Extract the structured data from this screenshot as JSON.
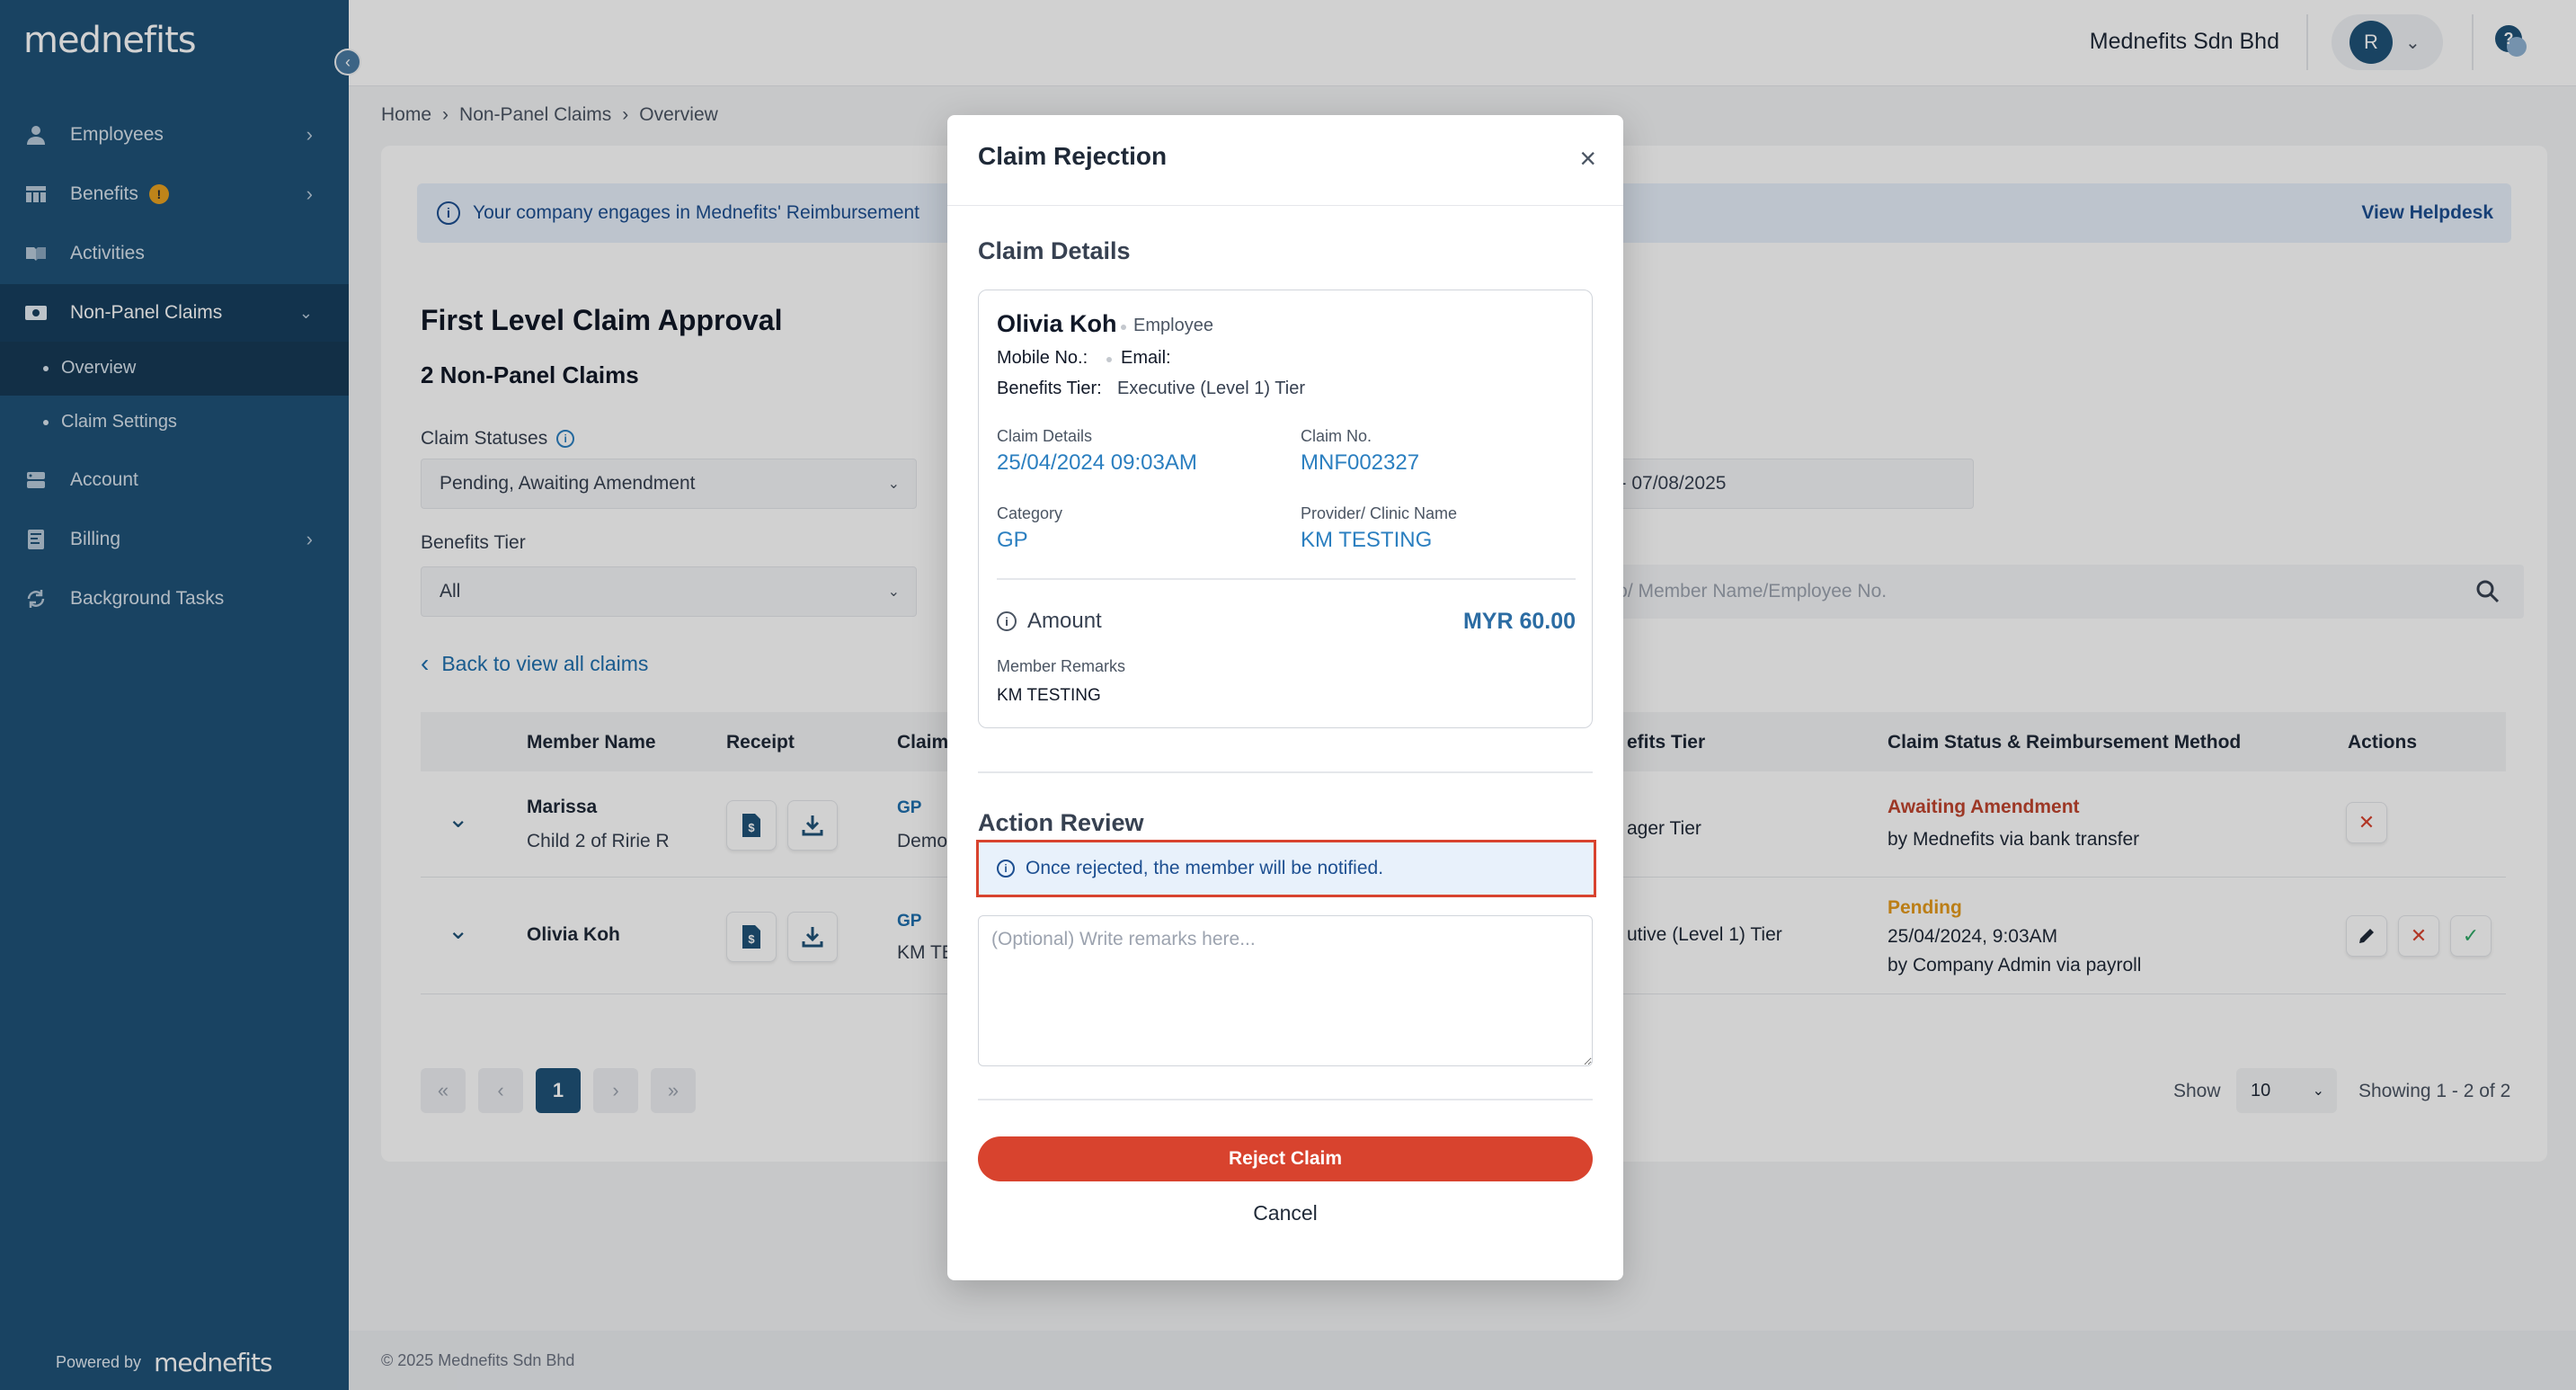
{
  "brand": {
    "logo_text": "mednefits",
    "powered_by": "Powered by",
    "powered_logo": "mednefits"
  },
  "sidebar": {
    "items": [
      {
        "label": "Employees",
        "icon": "person-icon"
      },
      {
        "label": "Benefits",
        "icon": "table-icon",
        "badge": "!"
      },
      {
        "label": "Activities",
        "icon": "book-icon"
      },
      {
        "label": "Non-Panel Claims",
        "icon": "money-icon"
      },
      {
        "label": "Account",
        "icon": "account-icon"
      },
      {
        "label": "Billing",
        "icon": "billing-icon"
      },
      {
        "label": "Background Tasks",
        "icon": "sync-icon"
      }
    ],
    "sub_items": [
      {
        "label": "Overview"
      },
      {
        "label": "Claim Settings"
      }
    ]
  },
  "topbar": {
    "company": "Mednefits Sdn Bhd",
    "avatar_initial": "R",
    "help_icon": "?"
  },
  "breadcrumb": {
    "home": "Home",
    "section": "Non-Panel Claims",
    "page": "Overview"
  },
  "banner": {
    "text": "Your company engages in Mednefits' Reimbursement",
    "link": "View Helpdesk"
  },
  "main": {
    "title": "First Level Claim Approval",
    "subtitle": "2 Non-Panel Claims",
    "status_label": "Claim Statuses",
    "status_value": "Pending, Awaiting Amendment",
    "date_value": "2 - 07/08/2025",
    "tier_label": "Benefits Tier",
    "tier_value": "All",
    "search_placeholder": "No/ Member Name/Employee No.",
    "back_link": "Back to view all claims"
  },
  "table": {
    "headers": {
      "member": "Member Name",
      "receipt": "Receipt",
      "claim": "Claim",
      "tier": "efits Tier",
      "status": "Claim Status & Reimbursement Method",
      "actions": "Actions"
    },
    "rows": [
      {
        "name": "Marissa",
        "relation": "Child 2 of Ririe R",
        "category": "GP",
        "provider": "Demo",
        "tier": "ager Tier",
        "status": "Awaiting Amendment",
        "method": "by Mednefits via bank transfer",
        "status_color": "#c0452f"
      },
      {
        "name": "Olivia Koh",
        "category": "GP",
        "provider": "KM TES",
        "tier": "utive (Level 1) Tier",
        "status": "Pending",
        "date": "25/04/2024, 9:03AM",
        "method": "by Company Admin via payroll",
        "status_color": "#e59a1b"
      }
    ]
  },
  "pagination": {
    "first": "«",
    "prev": "‹",
    "current": "1",
    "next": "›",
    "last": "»",
    "show_label": "Show",
    "page_size": "10",
    "showing": "Showing 1 - 2 of 2"
  },
  "footer": {
    "copyright": "© 2025 Mednefits Sdn Bhd"
  },
  "modal": {
    "title": "Claim Rejection",
    "close": "×",
    "details_title": "Claim Details",
    "employee_name": "Olivia Koh",
    "employee_role": "Employee",
    "mobile_label": "Mobile No.:",
    "email_label": "Email:",
    "tier_label": "Benefits Tier:",
    "tier_value": "Executive (Level 1) Tier",
    "claim_details_label": "Claim Details",
    "claim_details_value": "25/04/2024 09:03AM",
    "claim_no_label": "Claim No.",
    "claim_no_value": "MNF002327",
    "category_label": "Category",
    "category_value": "GP",
    "provider_label": "Provider/ Clinic Name",
    "provider_value": "KM TESTING",
    "amount_label": "Amount",
    "amount_value": "MYR 60.00",
    "remarks_label": "Member Remarks",
    "remarks_value": "KM TESTING",
    "action_title": "Action Review",
    "notice": "Once rejected, the member will be notified.",
    "remarks_placeholder": "(Optional) Write remarks here...",
    "reject_button": "Reject Claim",
    "cancel_button": "Cancel"
  },
  "colors": {
    "sidebar": "#1f5278",
    "accent": "#2b7fc0",
    "danger": "#d8432e",
    "warning": "#e59a1b"
  }
}
